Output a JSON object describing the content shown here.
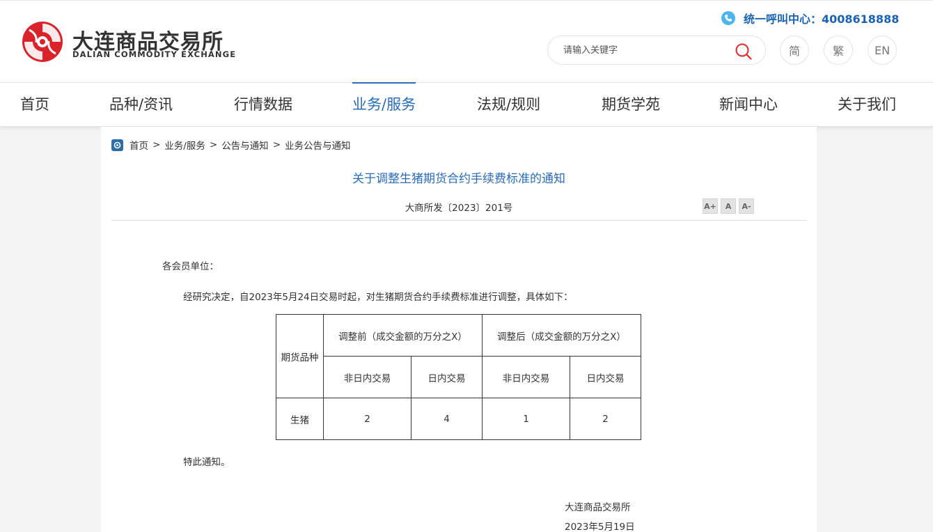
{
  "header": {
    "logo_cn": "大连商品交易所",
    "logo_en": "DALIAN COMMODITY EXCHANGE",
    "hotline": "统一呼叫中心：4008618888",
    "search_placeholder": "请输入关键字",
    "lang_simplified": "简",
    "lang_traditional": "繁",
    "lang_english": "EN"
  },
  "nav": {
    "items": [
      {
        "label": "首页"
      },
      {
        "label": "品种/资讯"
      },
      {
        "label": "行情数据"
      },
      {
        "label": "业务/服务"
      },
      {
        "label": "法规/规则"
      },
      {
        "label": "期货学苑"
      },
      {
        "label": "新闻中心"
      },
      {
        "label": "关于我们"
      }
    ],
    "active_index": 3
  },
  "breadcrumb": [
    "首页",
    "业务/服务",
    "公告与通知",
    "业务公告与通知"
  ],
  "breadcrumb_separator": ">",
  "article": {
    "title": "关于调整生猪期货合约手续费标准的通知",
    "doc_no": "大商所发〔2023〕201号",
    "font_tools": [
      "A+",
      "A",
      "A-"
    ],
    "salutation": "各会员单位：",
    "intro": "经研究决定，自2023年5月24日交易时起，对生猪期货合约手续费标准进行调整，具体如下：",
    "table": {
      "col_product": "期货品种",
      "group_before": "调整前（成交金额的万分之X）",
      "group_after": "调整后（成交金额的万分之X）",
      "sub_headers": [
        "非日内交易",
        "日内交易",
        "非日内交易",
        "日内交易"
      ],
      "rows": [
        {
          "product": "生猪",
          "values": [
            "2",
            "4",
            "1",
            "2"
          ]
        }
      ]
    },
    "closing": "特此通知。",
    "signature": "大连商品交易所",
    "date": "2023年5月19日"
  },
  "colors": {
    "accent_blue": "#2a6cb7",
    "hotline_blue": "#1a62b4",
    "logo_red": "#d9222a"
  }
}
